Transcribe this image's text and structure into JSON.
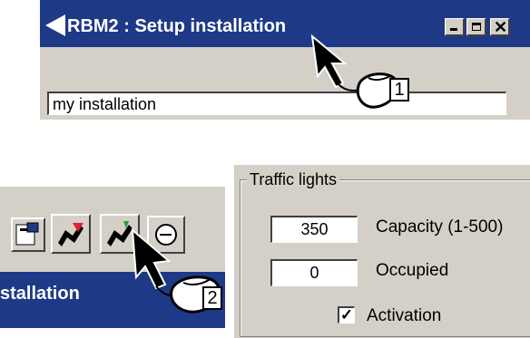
{
  "window": {
    "title": "RBM2 : Setup installation",
    "installation_name_value": "my installation"
  },
  "toolbar": {
    "title_fragment": "stallation",
    "buttons": [
      "properties-icon",
      "red-arrow-tool-icon",
      "green-arrow-tool-icon",
      "clock-icon"
    ]
  },
  "traffic_lights": {
    "group_label": "Traffic lights",
    "capacity_value": "350",
    "capacity_label": "Capacity (1-500)",
    "occupied_value": "0",
    "occupied_label": "Occupied",
    "activation_label": "Activation",
    "activation_checked": true
  },
  "callouts": {
    "step1": "1",
    "step2": "2"
  },
  "colors": {
    "titlebar": "#1e3a86",
    "panel": "#d4d0c8"
  }
}
